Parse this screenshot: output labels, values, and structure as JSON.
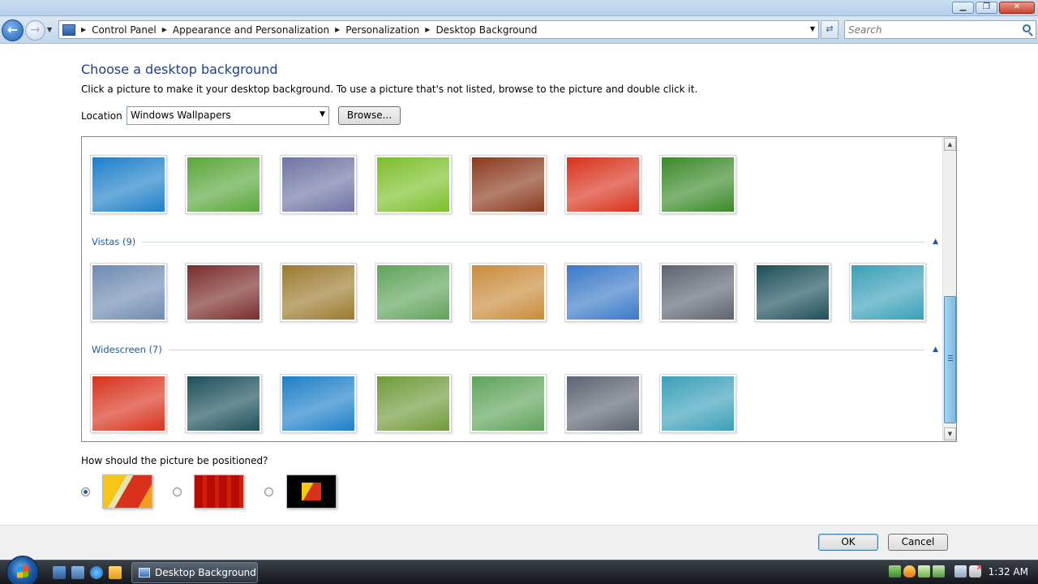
{
  "window": {
    "minimize_glyph": "▁",
    "maximize_glyph": "❐",
    "close_glyph": "✕"
  },
  "address": {
    "breadcrumbs": [
      "Control Panel",
      "Appearance and Personalization",
      "Personalization",
      "Desktop Background"
    ],
    "search_placeholder": "Search"
  },
  "page": {
    "heading": "Choose a desktop background",
    "instructions": "Click a picture to make it your desktop background. To use a picture that's not listed, browse to the picture and double click it.",
    "location_label": "Location",
    "location_value": "Windows Wallpapers",
    "browse_label": "Browse...",
    "position_question": "How should the picture be positioned?"
  },
  "gallery": {
    "groups": [
      {
        "name": "",
        "thumbs": [
          "#1d7fc9",
          "#5aa63a",
          "#6f74a3",
          "#7cbf2a",
          "#8a3a1e",
          "#d8321c",
          "#3b8a2a"
        ]
      },
      {
        "name": "Vistas (9)",
        "thumbs": [
          "#6e8bb0",
          "#7a2c2a",
          "#9b7a2f",
          "#5fa35a",
          "#c98b3a",
          "#3a79c8",
          "#5d6470",
          "#1d4f5a",
          "#3aa0b8"
        ]
      },
      {
        "name": "Widescreen (7)",
        "thumbs": [
          "#d8321c",
          "#1d4f5a",
          "#1d7fc9",
          "#6f9a3a",
          "#5fa35a",
          "#5d6470",
          "#3aa0b8"
        ]
      }
    ]
  },
  "positions": {
    "selected": 0
  },
  "buttons": {
    "ok": "OK",
    "cancel": "Cancel"
  },
  "taskbar": {
    "active_window": "Desktop Background",
    "clock": "1:32 AM"
  },
  "colors": {
    "heading": "#1e3f87",
    "group_heading": "#1e5aa8"
  }
}
